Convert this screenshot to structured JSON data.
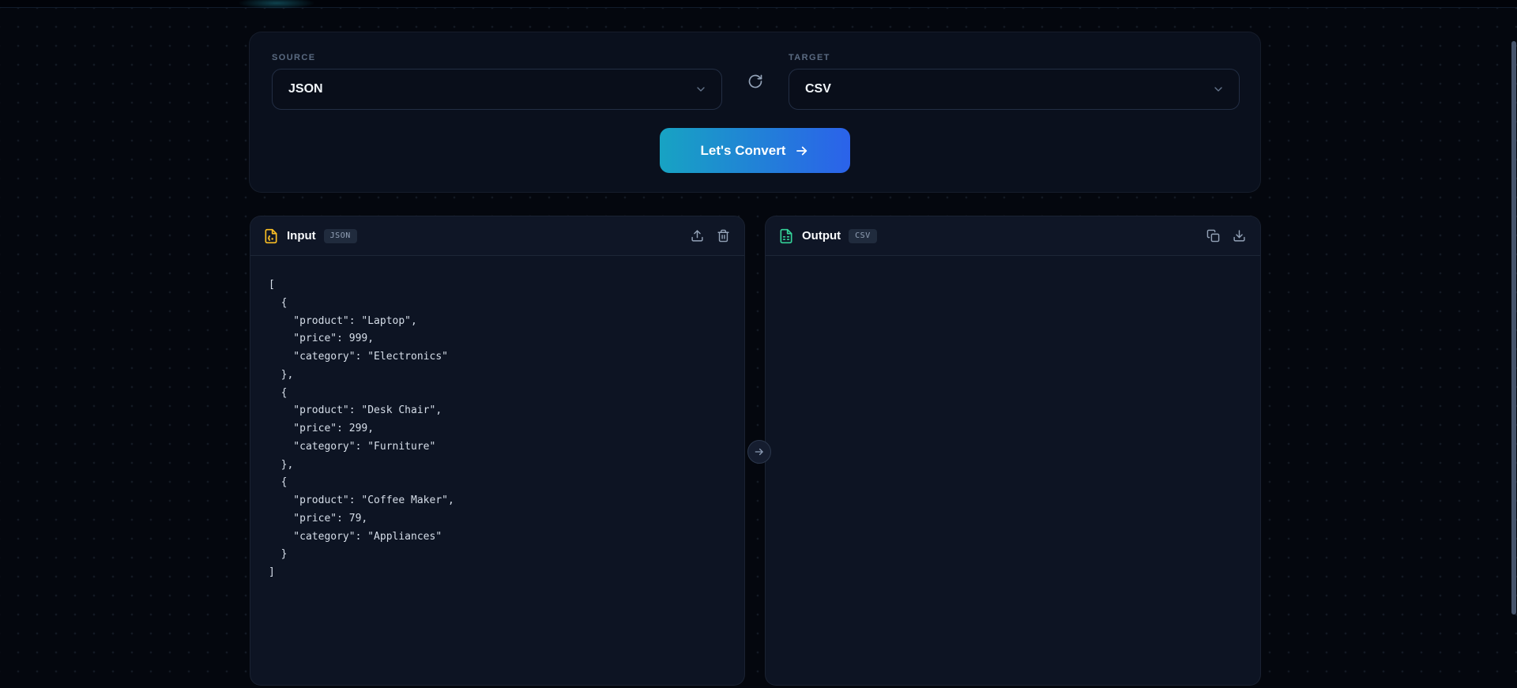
{
  "converter": {
    "source": {
      "label": "SOURCE",
      "value": "JSON"
    },
    "target": {
      "label": "TARGET",
      "value": "CSV"
    },
    "convert_button_label": "Let's Convert",
    "accent_gradient": [
      "#17a3c3",
      "#2b62ea"
    ]
  },
  "input_panel": {
    "title": "Input",
    "badge": "JSON",
    "icon": "file-json-icon",
    "icon_color": "#fbbf24",
    "code": "[\n  {\n    \"product\": \"Laptop\",\n    \"price\": 999,\n    \"category\": \"Electronics\"\n  },\n  {\n    \"product\": \"Desk Chair\",\n    \"price\": 299,\n    \"category\": \"Furniture\"\n  },\n  {\n    \"product\": \"Coffee Maker\",\n    \"price\": 79,\n    \"category\": \"Appliances\"\n  }\n]"
  },
  "output_panel": {
    "title": "Output",
    "badge": "CSV",
    "icon": "file-spreadsheet-icon",
    "icon_color": "#34d399",
    "content": ""
  },
  "colors": {
    "page_bg": "#04070e",
    "card_bg": "#0a101d",
    "panel_bg": "#0d1423",
    "panel_header_bg": "#0f1626",
    "muted_text": "#5b6b82",
    "icon_gray": "#94a3b8"
  }
}
